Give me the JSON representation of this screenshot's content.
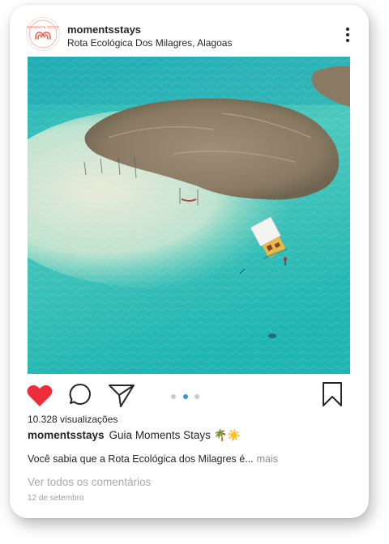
{
  "post": {
    "username": "momentsstays",
    "location": "Rota Ecológica Dos Milagres, Alagoas",
    "avatar_icon": "moments-stays-logo-icon",
    "avatar_logo_text": "MOMENTS STAYS",
    "image_description_icon": "aerial-beach-photo",
    "views": "10.328 visualizações",
    "caption_user": "momentsstays",
    "caption_text": "Guia Moments Stays 🌴☀️",
    "caption_body": "Você sabia que a Rota Ecológica dos Milagres é...",
    "more_label": "mais",
    "comments_link": "Ver todos os comentários",
    "date": "12 de setembro",
    "carousel": {
      "count": 3,
      "active_index": 1
    }
  },
  "actions": {
    "like_icon": "heart-filled-icon",
    "comment_icon": "comment-bubble-icon",
    "share_icon": "paper-plane-icon",
    "save_icon": "bookmark-icon",
    "more_icon": "more-vertical-icon"
  },
  "colors": {
    "like": "#ED2D3A",
    "accent": "#E8604C",
    "active_dot": "#3897D3",
    "text": "#262626",
    "muted": "#A8A8A8"
  }
}
